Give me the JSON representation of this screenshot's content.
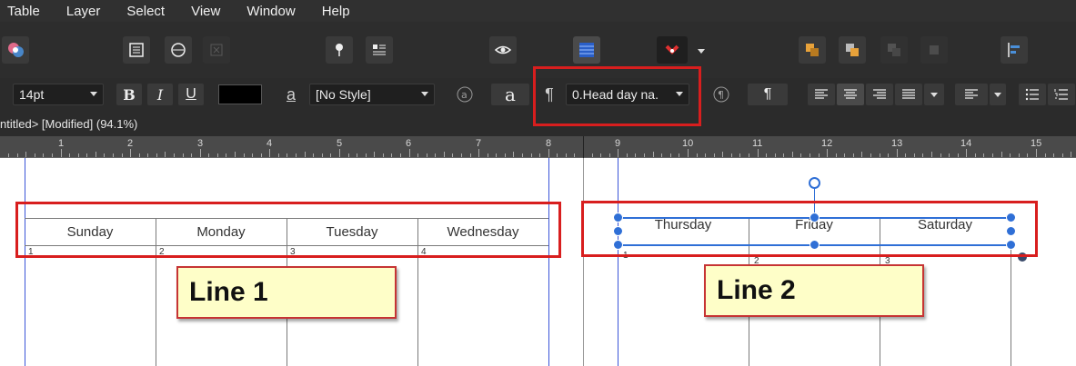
{
  "menu": [
    "Table",
    "Layer",
    "Select",
    "View",
    "Window",
    "Help"
  ],
  "context": {
    "font_size": "14pt",
    "bold": "B",
    "italic": "I",
    "underline": "U",
    "char_style_glyph": "a",
    "char_style": "[No Style]",
    "para_glyph": "¶",
    "para_style": "0.Head day na.",
    "text_color": "#000000"
  },
  "doc_status": "ntitled> [Modified] (94.1%)",
  "ruler": [
    "1",
    "2",
    "3",
    "4",
    "5",
    "6",
    "7",
    "8",
    "9",
    "10",
    "11",
    "12",
    "13",
    "14",
    "15"
  ],
  "table1": {
    "days": [
      "Sunday",
      "Monday",
      "Tuesday",
      "Wednesday"
    ],
    "numbers": [
      "1",
      "2",
      "3",
      "4"
    ]
  },
  "table2": {
    "days": [
      "Thursday",
      "Friday",
      "Saturday"
    ],
    "numbers": [
      "1",
      "2",
      "3"
    ]
  },
  "annotations": {
    "line1": "Line 1",
    "line2": "Line 2"
  },
  "colors": {
    "highlight_red": "#d81e1e",
    "selection_blue": "#2f6fd6",
    "guide_blue": "#3a55d8",
    "note_fill": "#fefec8"
  }
}
